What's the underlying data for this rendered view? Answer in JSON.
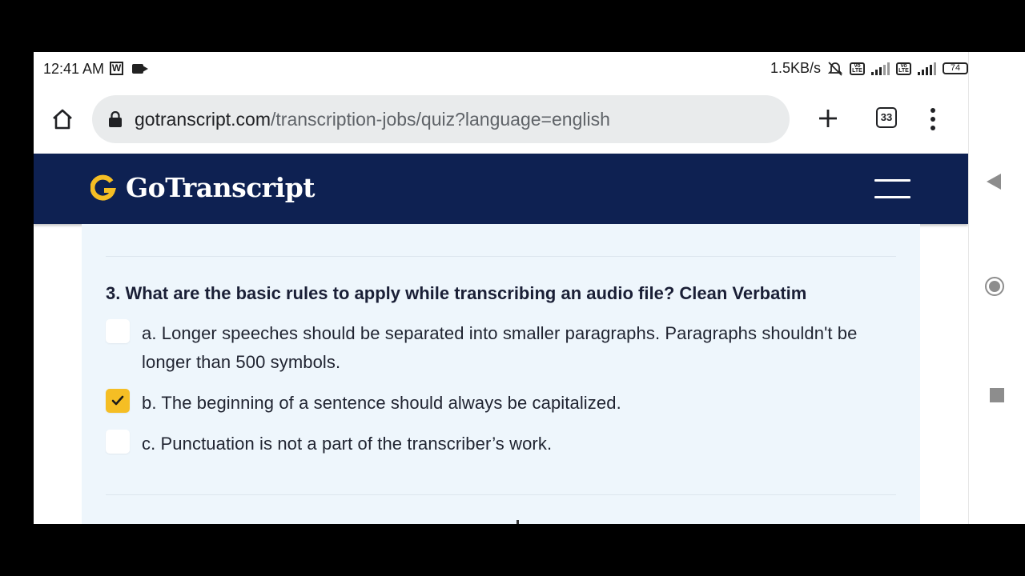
{
  "status_bar": {
    "time": "12:41 AM",
    "left_icons": [
      "w-app-icon",
      "video-camera-icon"
    ],
    "network_speed": "1.5KB/s",
    "battery": "74",
    "right_icons": [
      "mute-icon",
      "volte-icon",
      "signal-4g-icon",
      "volte-icon",
      "signal-icon",
      "battery-icon"
    ]
  },
  "browser": {
    "url_domain": "gotranscript.com",
    "url_path": "/transcription-jobs/quiz?language=english",
    "tab_count": "33",
    "icons": [
      "home-icon",
      "lock-icon",
      "plus-icon",
      "tabs-icon",
      "more-menu-icon"
    ]
  },
  "site_header": {
    "logo_text": "GoTranscript",
    "logo_letter": "G",
    "colors": {
      "header_bg": "#0e2152",
      "logo_accent": "#f5be24"
    }
  },
  "quiz": {
    "question": "3. What are the basic rules to apply while transcribing an audio file? Clean Verbatim",
    "options": [
      {
        "label": "a. Longer speeches should be separated into smaller paragraphs. Paragraphs shouldn't be longer than 500 symbols.",
        "checked": false
      },
      {
        "label": "b. The beginning of a sentence should always be capitalized.",
        "checked": true
      },
      {
        "label": "c. Punctuation is not a part of the transcriber’s work.",
        "checked": false
      }
    ],
    "colors": {
      "card_bg": "#eef6fc",
      "checkbox_checked": "#f5be24"
    }
  },
  "android_nav": {
    "icons": [
      "back-icon",
      "home-circle-icon",
      "recents-icon"
    ]
  }
}
